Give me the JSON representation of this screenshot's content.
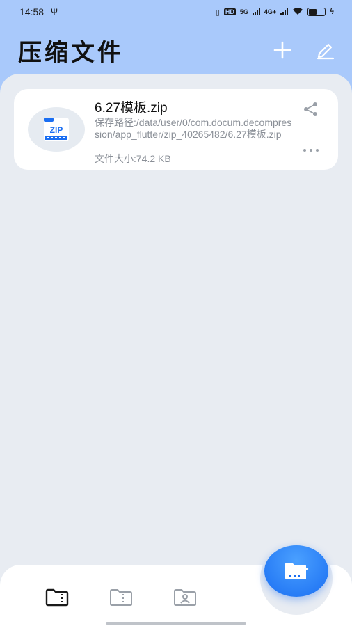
{
  "status_bar": {
    "time": "14:58",
    "hd_label": "HD",
    "sim1_label": "5G",
    "sim2_label": "4G+",
    "battery_level": 0.55
  },
  "header": {
    "title": "压缩文件"
  },
  "files": [
    {
      "name": "6.27模板.zip",
      "path": "保存路径:/data/user/0/com.docum.decompression/app_flutter/zip_40265482/6.27模板.zip",
      "size": "文件大小:74.2 KB",
      "thumb_label": "ZIP"
    }
  ],
  "colors": {
    "accent": "#1a6ef2",
    "header_bg": "#a9c9fb",
    "page_bg": "#e8ecf2"
  },
  "bottom_nav": {
    "items": [
      "compressed-files-icon",
      "zip-archive-icon",
      "user-folder-icon"
    ],
    "active_index": 0
  }
}
